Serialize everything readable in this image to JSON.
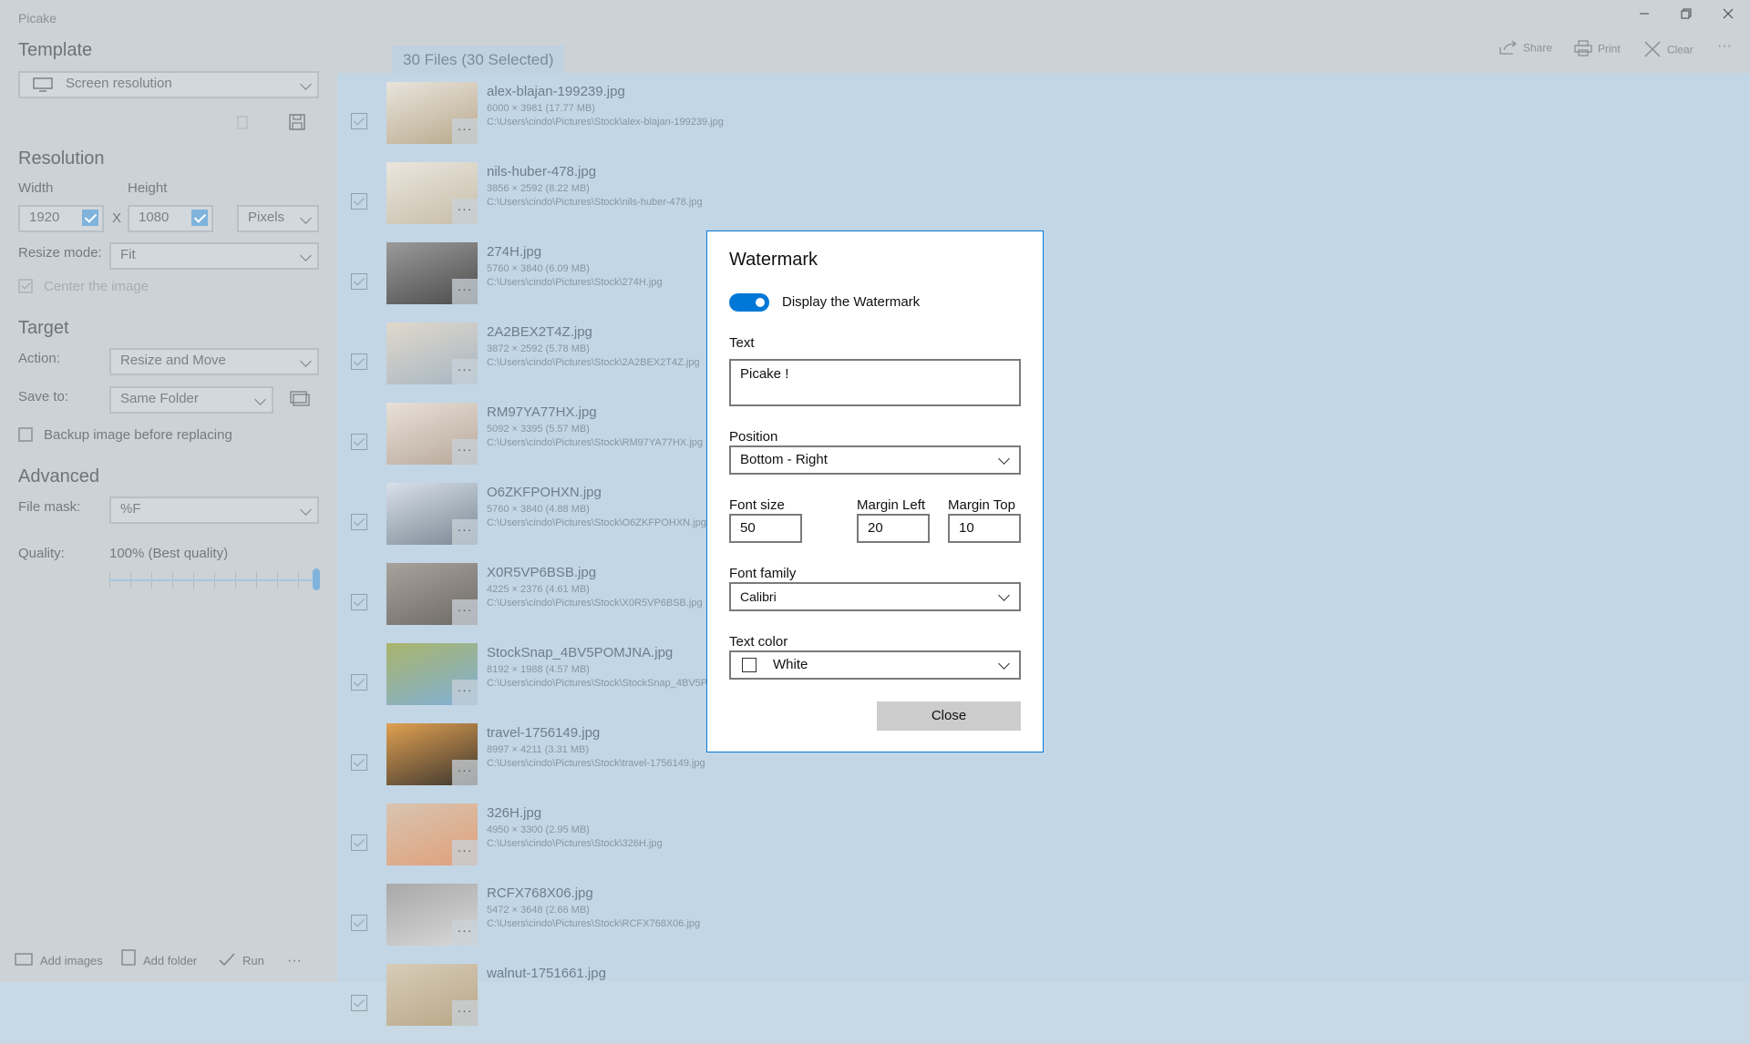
{
  "app": {
    "title": "Picake"
  },
  "left": {
    "template": {
      "heading": "Template",
      "selected": "Screen resolution"
    },
    "resolution": {
      "heading": "Resolution",
      "width_label": "Width",
      "height_label": "Height",
      "width": "1920",
      "height": "1080",
      "x": "X",
      "unit": "Pixels",
      "resize_mode_label": "Resize mode:",
      "resize_mode": "Fit",
      "center_label": "Center the image"
    },
    "target": {
      "heading": "Target",
      "action_label": "Action:",
      "action": "Resize and Move",
      "save_label": "Save to:",
      "save": "Same Folder",
      "backup_label": "Backup image before replacing"
    },
    "advanced": {
      "heading": "Advanced",
      "mask_label": "File mask:",
      "mask": "%F",
      "quality_label": "Quality:",
      "quality": "100% (Best quality)",
      "quality_value": 1.0
    },
    "bottombar": {
      "add_images": "Add images",
      "add_folder": "Add folder",
      "run": "Run",
      "more": "···"
    }
  },
  "header": {
    "files_tab": "30 Files (30 Selected)",
    "share": "Share",
    "print": "Print",
    "clear": "Clear",
    "more": "···"
  },
  "files": [
    {
      "name": "alex-blajan-199239.jpg",
      "dims": "6000 × 3981 (17.77 MB)",
      "path": "C:\\Users\\cindo\\Pictures\\Stock\\alex-blajan-199239.jpg",
      "c1": "#b9a98c",
      "c2": "#e8e4dc"
    },
    {
      "name": "nils-huber-478.jpg",
      "dims": "3856 × 2592 (8.22 MB)",
      "path": "C:\\Users\\cindo\\Pictures\\Stock\\nils-huber-478.jpg",
      "c1": "#c7bda8",
      "c2": "#eae6de"
    },
    {
      "name": "274H.jpg",
      "dims": "5760 × 3840 (6.09 MB)",
      "path": "C:\\Users\\cindo\\Pictures\\Stock\\274H.jpg",
      "c1": "#4c4c4c",
      "c2": "#9a9a9a"
    },
    {
      "name": "2A2BEX2T4Z.jpg",
      "dims": "3872 × 2592 (5.78 MB)",
      "path": "C:\\Users\\cindo\\Pictures\\Stock\\2A2BEX2T4Z.jpg",
      "c1": "#a7b6c2",
      "c2": "#e0d8cc"
    },
    {
      "name": "RM97YA77HX.jpg",
      "dims": "5092 × 3395 (5.57 MB)",
      "path": "C:\\Users\\cindo\\Pictures\\Stock\\RM97YA77HX.jpg",
      "c1": "#b8a89a",
      "c2": "#e8e0d8"
    },
    {
      "name": "O6ZKFPOHXN.jpg",
      "dims": "5760 × 3840 (4.88 MB)",
      "path": "C:\\Users\\cindo\\Pictures\\Stock\\O6ZKFPOHXN.jpg",
      "c1": "#7a8794",
      "c2": "#d8e0e8"
    },
    {
      "name": "X0R5VP6BSB.jpg",
      "dims": "4225 × 2376 (4.61 MB)",
      "path": "C:\\Users\\cindo\\Pictures\\Stock\\X0R5VP6BSB.jpg",
      "c1": "#6e6a66",
      "c2": "#a8a29c"
    },
    {
      "name": "StockSnap_4BV5POMJNA.jpg",
      "dims": "8192 × 1988 (4.57 MB)",
      "path": "C:\\Users\\cindo\\Pictures\\Stock\\StockSnap_4BV5POMJNA.jpg",
      "c1": "#7fb0d8",
      "c2": "#a9b46a"
    },
    {
      "name": "travel-1756149.jpg",
      "dims": "8997 × 4211 (3.31 MB)",
      "path": "C:\\Users\\cindo\\Pictures\\Stock\\travel-1756149.jpg",
      "c1": "#3c3630",
      "c2": "#e0a050"
    },
    {
      "name": "326H.jpg",
      "dims": "4950 × 3300 (2.95 MB)",
      "path": "C:\\Users\\cindo\\Pictures\\Stock\\326H.jpg",
      "c1": "#e0a07a",
      "c2": "#d8c4b0"
    },
    {
      "name": "RCFX768X06.jpg",
      "dims": "5472 × 3648 (2.66 MB)",
      "path": "C:\\Users\\cindo\\Pictures\\Stock\\RCFX768X06.jpg",
      "c1": "#d8d8d8",
      "c2": "#a8a8a8"
    },
    {
      "name": "walnut-1751661.jpg",
      "dims": "",
      "path": "",
      "c1": "#b8a888",
      "c2": "#d8ccb8"
    }
  ],
  "dialog": {
    "title": "Watermark",
    "toggle_label": "Display the Watermark",
    "toggle_on": true,
    "text_label": "Text",
    "text": "Picake !",
    "position_label": "Position",
    "position": "Bottom - Right",
    "font_size_label": "Font size",
    "font_size": "50",
    "margin_left_label": "Margin Left",
    "margin_left": "20",
    "margin_top_label": "Margin Top",
    "margin_top": "10",
    "font_family_label": "Font family",
    "font_family": "Calibri",
    "text_color_label": "Text color",
    "text_color": "White",
    "close": "Close"
  }
}
